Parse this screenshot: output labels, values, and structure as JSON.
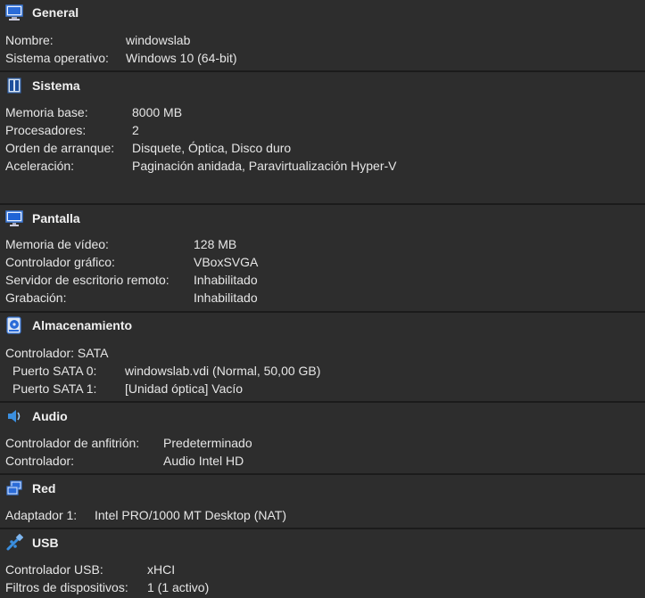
{
  "general": {
    "title": "General",
    "rows": [
      {
        "label": "Nombre:",
        "value": "windowslab"
      },
      {
        "label": "Sistema operativo:",
        "value": "Windows 10 (64-bit)"
      }
    ]
  },
  "sistema": {
    "title": "Sistema",
    "rows": [
      {
        "label": "Memoria base:",
        "value": "8000 MB"
      },
      {
        "label": "Procesadores:",
        "value": "2"
      },
      {
        "label": "Orden de arranque:",
        "value": "Disquete, Óptica, Disco duro"
      },
      {
        "label": "Aceleración:",
        "value": "Paginación anidada, Paravirtualización Hyper-V"
      }
    ]
  },
  "pantalla": {
    "title": "Pantalla",
    "rows": [
      {
        "label": "Memoria de vídeo:",
        "value": "128 MB"
      },
      {
        "label": "Controlador gráfico:",
        "value": "VBoxSVGA"
      },
      {
        "label": "Servidor de escritorio remoto:",
        "value": "Inhabilitado"
      },
      {
        "label": "Grabación:",
        "value": "Inhabilitado"
      }
    ]
  },
  "almacenamiento": {
    "title": "Almacenamiento",
    "controller": "Controlador: SATA",
    "rows": [
      {
        "label": "Puerto SATA 0:",
        "value": "windowslab.vdi (Normal, 50,00 GB)"
      },
      {
        "label": "Puerto SATA 1:",
        "value": "[Unidad óptica] Vacío"
      }
    ]
  },
  "audio": {
    "title": "Audio",
    "rows": [
      {
        "label": "Controlador de anfitrión:",
        "value": "Predeterminado"
      },
      {
        "label": "Controlador:",
        "value": "Audio Intel HD"
      }
    ]
  },
  "red": {
    "title": "Red",
    "rows": [
      {
        "label": "Adaptador 1:",
        "value": "Intel PRO/1000 MT Desktop (NAT)"
      }
    ]
  },
  "usb": {
    "title": "USB",
    "rows": [
      {
        "label": "Controlador USB:",
        "value": "xHCI"
      },
      {
        "label": "Filtros de dispositivos:",
        "value": "1 (1 activo)"
      }
    ]
  },
  "icons": {
    "general": "monitor-icon",
    "sistema": "chip-icon",
    "pantalla": "display-icon",
    "almacenamiento": "storage-icon",
    "audio": "speaker-icon",
    "red": "network-icon",
    "usb": "usb-icon"
  }
}
